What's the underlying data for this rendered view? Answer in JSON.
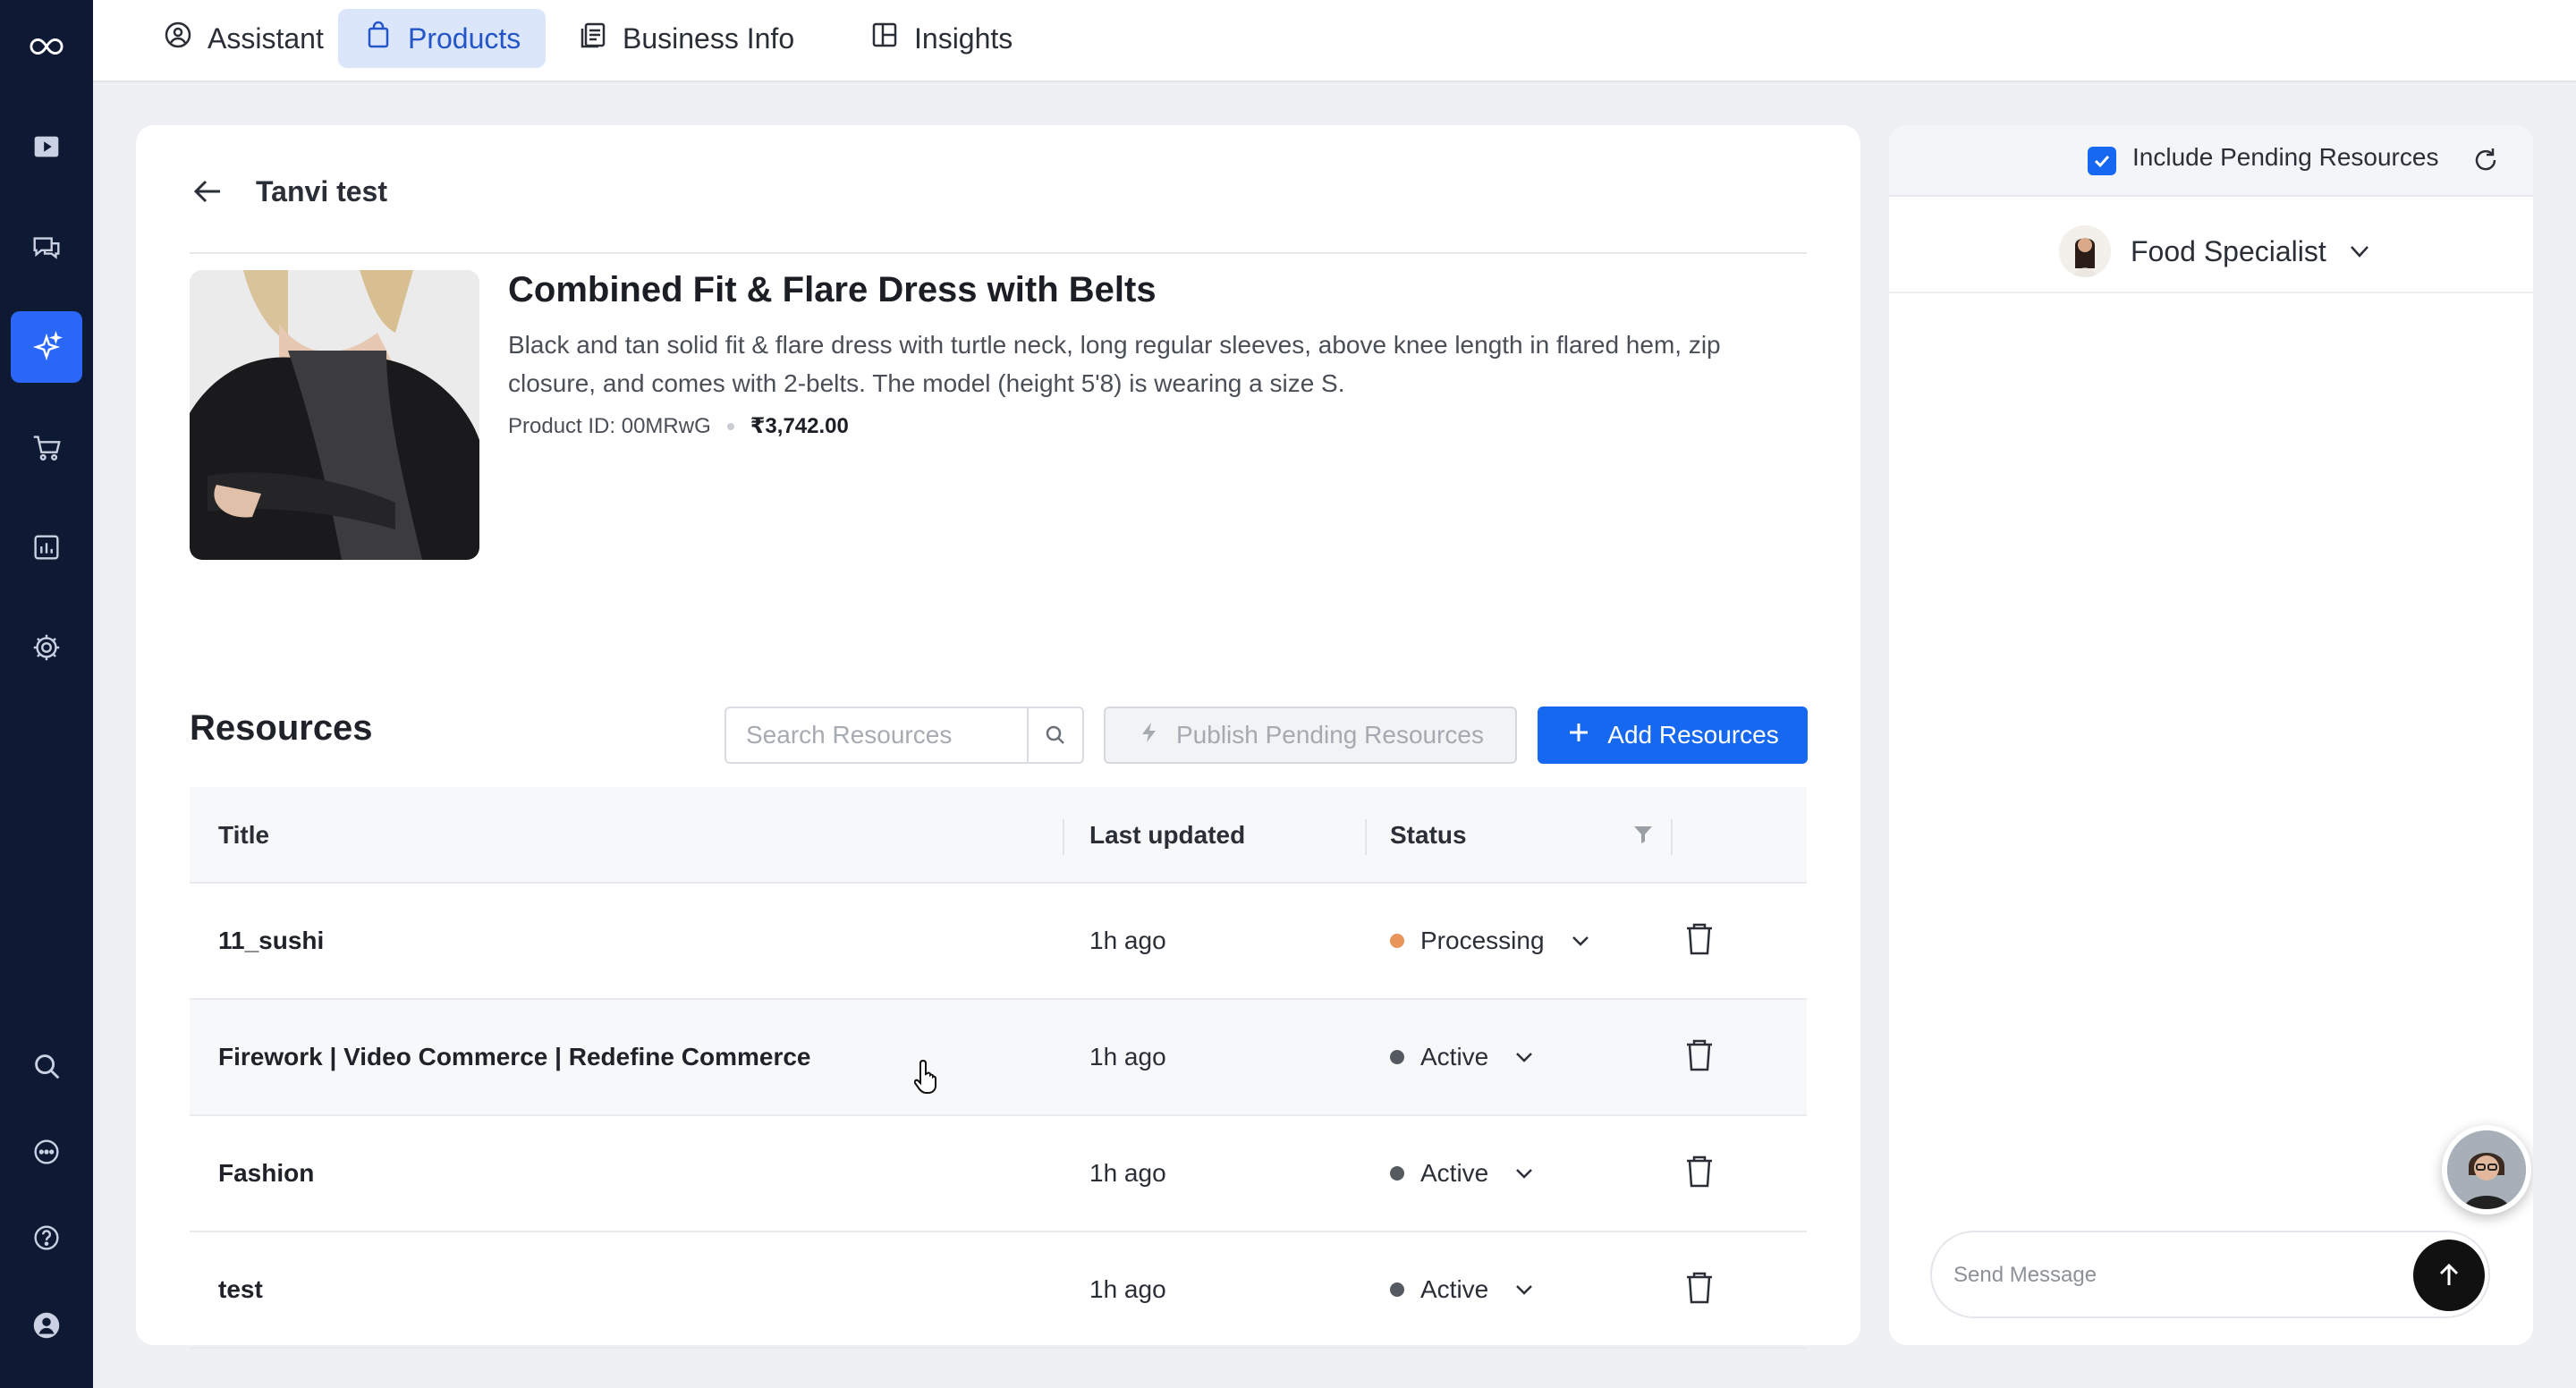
{
  "rail": {
    "items": [
      {
        "icon": "logo-infinity-icon",
        "active": false
      },
      {
        "icon": "video-icon",
        "active": false
      },
      {
        "icon": "chat-icon",
        "active": false
      },
      {
        "icon": "sparkle-icon",
        "active": true
      },
      {
        "icon": "cart-icon",
        "active": false
      },
      {
        "icon": "analytics-icon",
        "active": false
      },
      {
        "icon": "gear-icon",
        "active": false
      },
      {
        "icon": "search-icon",
        "active": false
      },
      {
        "icon": "message-dots-icon",
        "active": false
      },
      {
        "icon": "help-icon",
        "active": false
      },
      {
        "icon": "user-icon",
        "active": false
      }
    ]
  },
  "nav": {
    "tabs": [
      {
        "label": "Assistant",
        "icon": "user-circle-icon",
        "active": false
      },
      {
        "label": "Products",
        "icon": "shopping-bag-icon",
        "active": true
      },
      {
        "label": "Business Info",
        "icon": "document-icon",
        "active": false
      },
      {
        "label": "Insights",
        "icon": "layout-icon",
        "active": false
      }
    ]
  },
  "main": {
    "back_title": "Tanvi test",
    "product": {
      "title": "Combined Fit & Flare Dress with Belts",
      "description": "Black and tan solid fit & flare dress with turtle neck, long regular sleeves, above knee length in flared hem, zip closure, and comes with 2-belts. The model (height 5'8) is wearing a size S.",
      "id_label": "Product ID: 00MRwG",
      "price": "₹3,742.00"
    },
    "resources": {
      "title": "Resources",
      "search_placeholder": "Search Resources",
      "publish_label": "Publish Pending Resources",
      "add_label": "Add Resources",
      "columns": {
        "title": "Title",
        "last_updated": "Last updated",
        "status": "Status"
      },
      "rows": [
        {
          "title": "11_sushi",
          "last_updated": "1h ago",
          "status": "Processing",
          "status_color": "#e8955a"
        },
        {
          "title": "Firework | Video Commerce | Redefine Commerce",
          "last_updated": "1h ago",
          "status": "Active",
          "status_color": "#555a61"
        },
        {
          "title": "Fashion",
          "last_updated": "1h ago",
          "status": "Active",
          "status_color": "#555a61"
        },
        {
          "title": "test",
          "last_updated": "1h ago",
          "status": "Active",
          "status_color": "#555a61"
        }
      ]
    }
  },
  "panel": {
    "include_pending_label": "Include Pending Resources",
    "include_pending_checked": true,
    "agent_name": "Food Specialist",
    "message_placeholder": "Send Message"
  },
  "colors": {
    "rail_bg": "#0e1a33",
    "accent": "#1668f0",
    "active_tab_bg": "#dbe6fb"
  }
}
